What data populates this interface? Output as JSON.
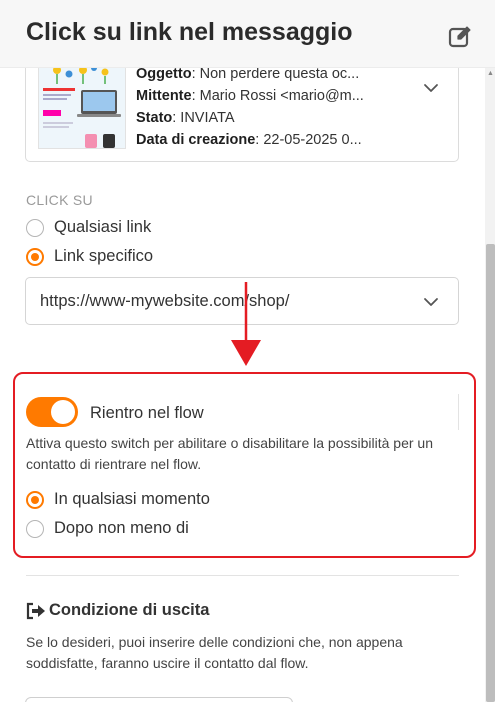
{
  "header": {
    "title": "Click su link nel messaggio",
    "edit_icon": "edit-icon"
  },
  "message": {
    "rows": [
      {
        "label": "Oggetto",
        "value": ": Non perdere questa oc..."
      },
      {
        "label": "Mittente",
        "value": ": Mario Rossi <mario@m..."
      },
      {
        "label": "Stato",
        "value": ": INVIATA"
      },
      {
        "label": "Data di creazione",
        "value": ": 22-05-2025 0..."
      }
    ],
    "expand_icon": "chevron-down-icon"
  },
  "click_on": {
    "label": "CLICK SU",
    "options": [
      {
        "label": "Qualsiasi link",
        "selected": false
      },
      {
        "label": "Link specifico",
        "selected": true
      }
    ],
    "url_value": "https://www-mywebsite.com/shop/"
  },
  "reentry": {
    "toggle_on": true,
    "label": "Rientro nel flow",
    "description": "Attiva questo switch per abilitare o disabilitare la possibilità per un contatto di rientrare nel flow.",
    "options": [
      {
        "label": "In qualsiasi momento",
        "selected": true
      },
      {
        "label": "Dopo non meno di",
        "selected": false
      }
    ]
  },
  "exit": {
    "title": "Condizione di uscita",
    "icon": "sign-out-icon",
    "description": "Se lo desideri, puoi inserire delle condizioni che, non appena soddisfatte, faranno uscire il contatto dal flow."
  },
  "colors": {
    "accent": "#ff7a00",
    "highlight": "#e41c23"
  }
}
